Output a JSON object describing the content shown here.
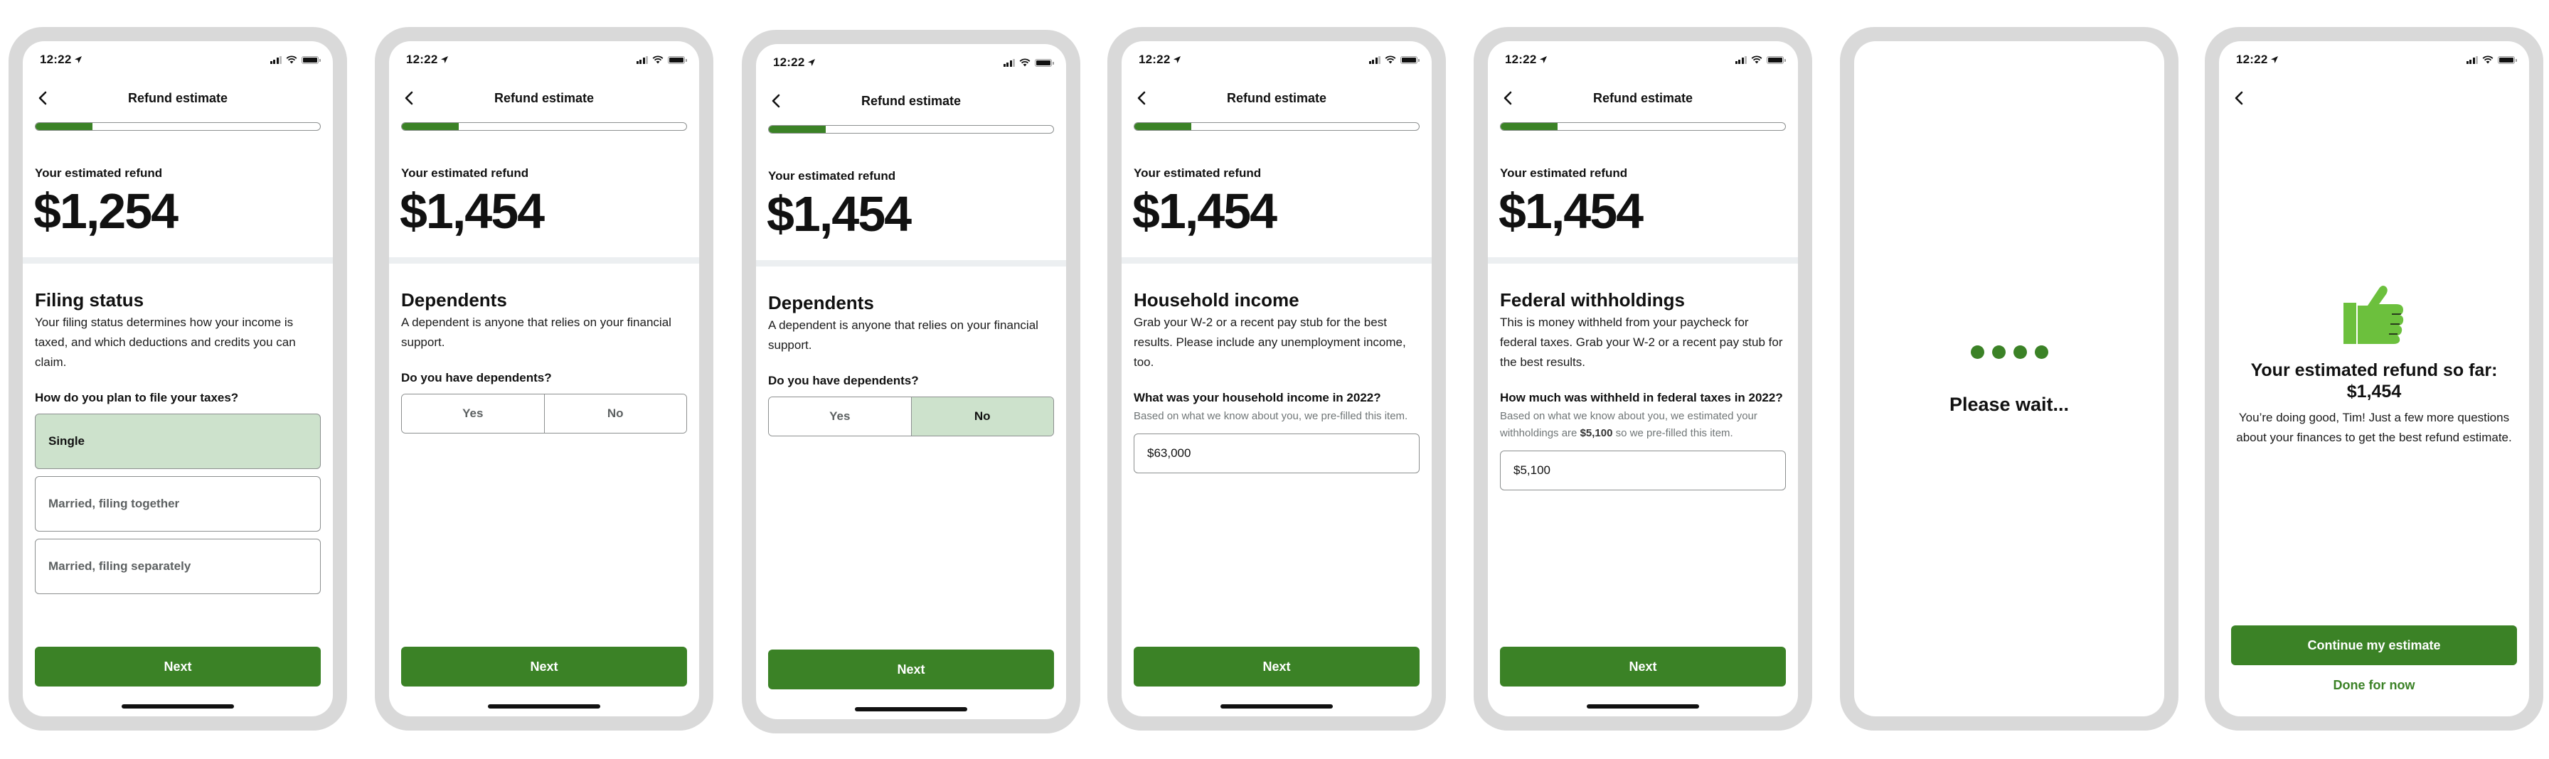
{
  "theme": {
    "accent": "#3b8226",
    "selected_bg": "#cde2cc",
    "frame": "#d9d9d9",
    "thumb": "#6cc03d"
  },
  "status_bar": {
    "time": "12:22"
  },
  "screens": [
    {
      "nav_title": "Refund estimate",
      "progress": 0.2,
      "refund_label": "Your estimated refund",
      "refund_amount": "$1,254",
      "section_title": "Filing status",
      "section_desc": "Your filing status determines how your income is taxed, and which deductions and credits you can claim.",
      "question": "How do you plan to file your taxes?",
      "options": [
        {
          "label": "Single",
          "selected": true
        },
        {
          "label": "Married, filing together",
          "selected": false
        },
        {
          "label": "Married, filing separately",
          "selected": false
        }
      ],
      "primary_button": "Next"
    },
    {
      "nav_title": "Refund estimate",
      "progress": 0.2,
      "refund_label": "Your estimated refund",
      "refund_amount": "$1,454",
      "section_title": "Dependents",
      "section_desc": "A dependent is anyone that relies on your financial support.",
      "question": "Do you have dependents?",
      "choices": [
        {
          "label": "Yes",
          "selected": false
        },
        {
          "label": "No",
          "selected": false
        }
      ],
      "primary_button": "Next"
    },
    {
      "nav_title": "Refund estimate",
      "progress": 0.2,
      "refund_label": "Your estimated refund",
      "refund_amount": "$1,454",
      "section_title": "Dependents",
      "section_desc": "A dependent is anyone that relies on your financial support.",
      "question": "Do you have dependents?",
      "choices": [
        {
          "label": "Yes",
          "selected": false
        },
        {
          "label": "No",
          "selected": true
        }
      ],
      "primary_button": "Next"
    },
    {
      "nav_title": "Refund estimate",
      "progress": 0.2,
      "refund_label": "Your estimated refund",
      "refund_amount": "$1,454",
      "section_title": "Household income",
      "section_desc": "Grab your W-2 or a recent pay stub for the best results. Please include any unemployment income, too.",
      "question": "What was your household income in 2022?",
      "hint": "Based on what we know about you, we pre-filled this item.",
      "input_value": "$63,000",
      "primary_button": "Next"
    },
    {
      "nav_title": "Refund estimate",
      "progress": 0.2,
      "refund_label": "Your estimated refund",
      "refund_amount": "$1,454",
      "section_title": "Federal withholdings",
      "section_desc": "This is money withheld from your paycheck for federal taxes. Grab your W-2 or a recent pay stub for the best results.",
      "question": "How much was withheld in federal taxes in 2022?",
      "hint_before": "Based on what we know about you, we estimated your withholdings are ",
      "hint_bold": "$5,100",
      "hint_after": " so we pre-filled this item.",
      "input_value": "$5,100",
      "primary_button": "Next"
    },
    {
      "loading_text": "Please wait..."
    },
    {
      "success_title_line1": "Your estimated refund so far:",
      "success_title_line2": "$1,454",
      "success_desc": "You’re doing good, Tim! Just a few more questions about your finances to get the best refund estimate.",
      "primary_button": "Continue my estimate",
      "secondary_button": "Done for now"
    }
  ]
}
